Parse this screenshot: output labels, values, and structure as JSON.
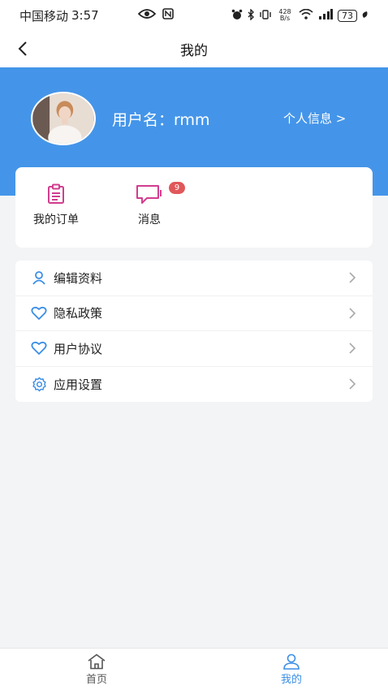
{
  "status_bar": {
    "carrier": "中国移动",
    "time": "3:57",
    "net_speed": "428 B/s",
    "battery": "73"
  },
  "nav": {
    "title": "我的"
  },
  "profile": {
    "username": "用户名：rmm",
    "profile_link": "个人信息 >"
  },
  "quick_actions": {
    "orders_label": "我的订单",
    "messages_label": "消息",
    "messages_badge": "9"
  },
  "menu": {
    "items": [
      {
        "label": "编辑资料",
        "icon": "user-icon"
      },
      {
        "label": "隐私政策",
        "icon": "heart-icon"
      },
      {
        "label": "用户协议",
        "icon": "heart-icon"
      },
      {
        "label": "应用设置",
        "icon": "gear-icon"
      }
    ]
  },
  "tab_bar": {
    "home_label": "首页",
    "mine_label": "我的",
    "active_color": "#3a8ee6"
  },
  "colors": {
    "header_blue": "#4495e9",
    "icon_pink": "#d13d8f",
    "icon_blue": "#3a8ee6",
    "badge_red": "#e0575a"
  }
}
